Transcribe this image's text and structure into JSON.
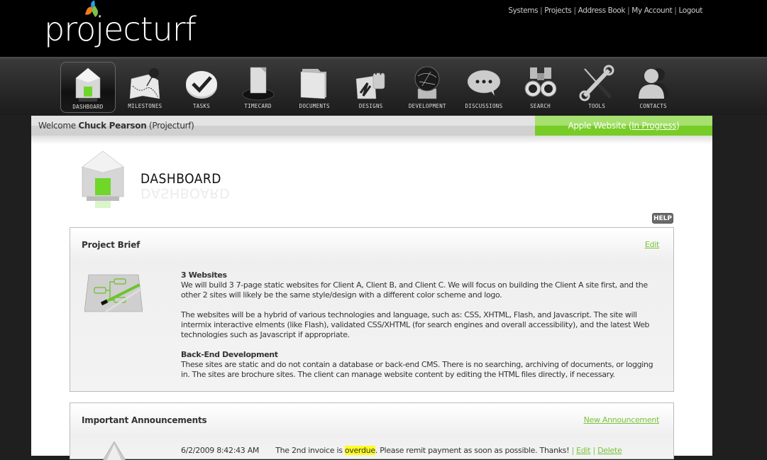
{
  "app": {
    "logo_text": "projecturf",
    "logo_leaf_colors": [
      "#f07c1e",
      "#2b9be3",
      "#7cc242"
    ]
  },
  "top_links": [
    "Systems",
    "Projects",
    "Address Book",
    "My Account",
    "Logout"
  ],
  "nav": {
    "active": "DASHBOARD",
    "items": [
      {
        "label": "DASHBOARD",
        "icon": "house-icon"
      },
      {
        "label": "MILESTONES",
        "icon": "map-pin-icon"
      },
      {
        "label": "TASKS",
        "icon": "checkmark-icon"
      },
      {
        "label": "TIMECARD",
        "icon": "timecard-icon"
      },
      {
        "label": "DOCUMENTS",
        "icon": "folder-icon"
      },
      {
        "label": "DESIGNS",
        "icon": "brush-cup-icon"
      },
      {
        "label": "DEVELOPMENT",
        "icon": "globe-icon"
      },
      {
        "label": "DISCUSSIONS",
        "icon": "speech-bubble-icon"
      },
      {
        "label": "SEARCH",
        "icon": "binoculars-icon"
      },
      {
        "label": "TOOLS",
        "icon": "tools-icon"
      },
      {
        "label": "CONTACTS",
        "icon": "contacts-icon"
      }
    ]
  },
  "welcome": {
    "prefix": "Welcome",
    "user": "Chuck Pearson",
    "org": "(Projecturf)"
  },
  "project_status": {
    "name": "Apple Website",
    "status": "In Progress",
    "accent_color": "#78cc26"
  },
  "page": {
    "title": "DASHBOARD",
    "help_label": "HELP"
  },
  "brief": {
    "title": "Project Brief",
    "edit_label": "Edit",
    "sections": [
      {
        "heading": "3 Websites",
        "paragraphs": [
          "We will build 3 7-page static websites for Client A, Client B, and Client C. We will focus on building the Client A site first, and the other 2 sites will likely be the same style/design with a different color scheme and logo.",
          "The websites will be a hybrid of various technologies and language, such as: CSS, XHTML, Flash, and Javascript. The site will intermix interactive elments (like Flash), validated CSS/XHTML (for search engines and overall accessibility), and the latest Web technologies such as Javascript if appropriate."
        ]
      },
      {
        "heading": "Back-End Development",
        "paragraphs": [
          "These sites are static and do not contain a database or back-end CMS. There is no searching, archiving of documents, or logging in. The sites are brochure sites. The client can manage website content by editing the HTML files directly, if necessary."
        ]
      }
    ]
  },
  "announcements": {
    "title": "Important Announcements",
    "new_label": "New Announcement",
    "items": [
      {
        "date": "6/2/2009 8:42:43 AM",
        "text_before": "The 2nd invoice is ",
        "highlight": "overdue",
        "text_after": ". Please remit payment as soon as possible. Thanks!",
        "edit_label": "Edit",
        "delete_label": "Delete"
      }
    ]
  }
}
